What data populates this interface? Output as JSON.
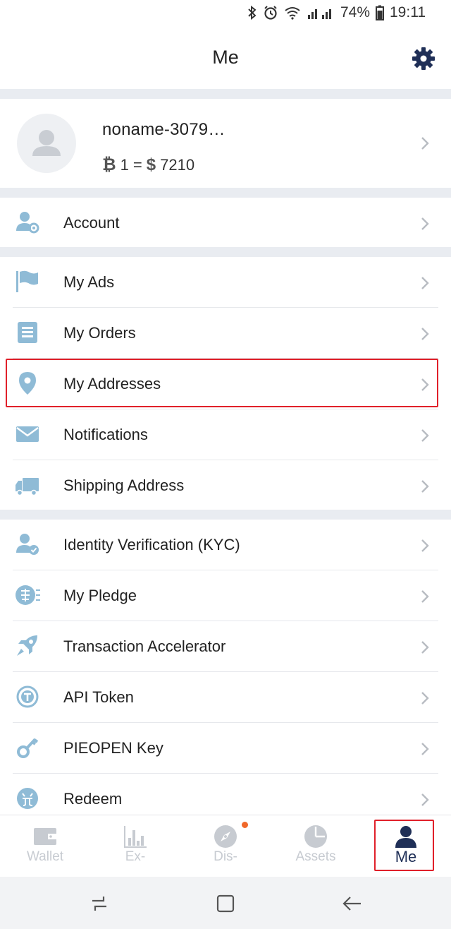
{
  "status": {
    "battery": "74%",
    "time": "19:11"
  },
  "header": {
    "title": "Me"
  },
  "profile": {
    "name": "noname-3079…",
    "rate_one": "1 =",
    "rate_value": "7210"
  },
  "menu": [
    {
      "label": "Account",
      "icon": "account-settings-icon"
    },
    {
      "label": "My Ads",
      "icon": "flag-icon"
    },
    {
      "label": "My Orders",
      "icon": "orders-list-icon"
    },
    {
      "label": "My Addresses",
      "icon": "location-pin-icon"
    },
    {
      "label": "Notifications",
      "icon": "envelope-icon"
    },
    {
      "label": "Shipping Address",
      "icon": "truck-icon"
    },
    {
      "label": "Identity Verification (KYC)",
      "icon": "verified-user-icon"
    },
    {
      "label": "My Pledge",
      "icon": "pledge-icon"
    },
    {
      "label": "Transaction Accelerator",
      "icon": "rocket-icon"
    },
    {
      "label": "API Token",
      "icon": "token-icon"
    },
    {
      "label": "PIEOPEN Key",
      "icon": "key-icon"
    },
    {
      "label": "Redeem",
      "icon": "redeem-icon"
    }
  ],
  "tabs": [
    {
      "label": "Wallet",
      "icon": "wallet-icon"
    },
    {
      "label": "Ex-",
      "icon": "exchange-chart-icon"
    },
    {
      "label": "Dis-",
      "icon": "compass-icon"
    },
    {
      "label": "Assets",
      "icon": "pie-chart-icon"
    },
    {
      "label": "Me",
      "icon": "person-icon",
      "active": true
    }
  ],
  "colors": {
    "accent": "#1f2f57",
    "icon": "#8fbbd6",
    "highlight": "#e0202a",
    "badge": "#f0682a",
    "gap": "#e9ecf1"
  }
}
